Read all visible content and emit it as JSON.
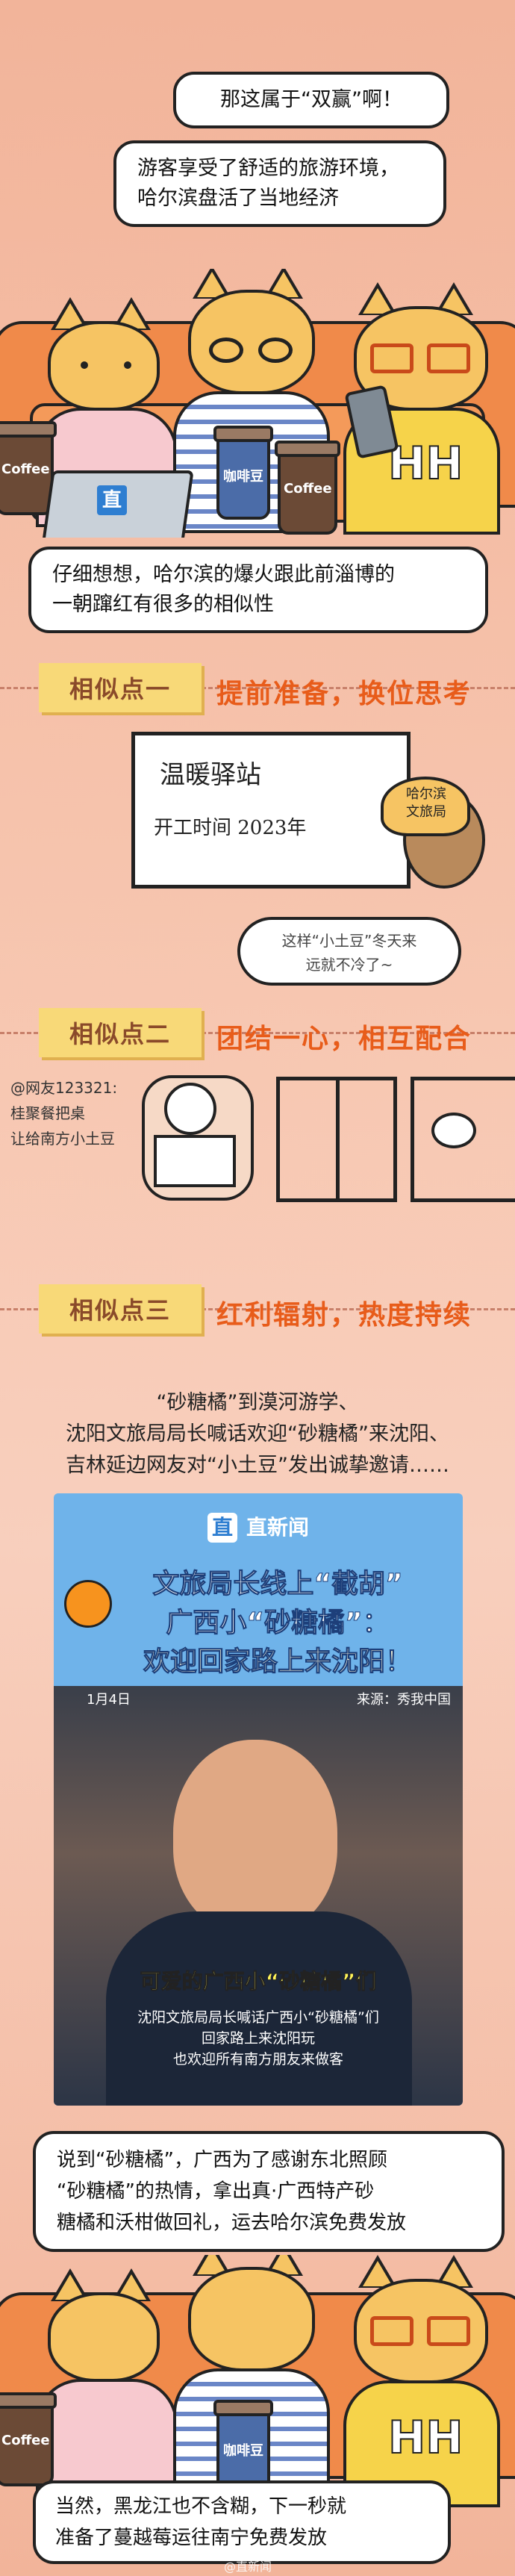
{
  "scene1": {
    "bubble_top": "那这属于“双赢”啊！",
    "bubble_mid_line1": "游客享受了舒适的旅游环境，",
    "bubble_mid_line2": "哈尔滨盘活了当地经济",
    "cup_left_label": "Coffee",
    "cup_mid_label": "咖啡豆",
    "cup_right_label": "Coffee",
    "laptop_logo": "直",
    "shirt_letters": "HH"
  },
  "bubble_similar_line1": "仔细想想，哈尔滨的爆火跟此前淄博的",
  "bubble_similar_line2": "一朝蹿红有很多的相似性",
  "point1": {
    "label": "相似点一",
    "title": "提前准备，换位思考",
    "board_title": "温暖驿站",
    "board_text": "开工时间 2023年",
    "mascot_text_line1": "哈尔滨",
    "mascot_text_line2": "文旅局",
    "speech_line1": "这样“小土豆”冬天来",
    "speech_line2": "远就不冷了~"
  },
  "point2": {
    "label": "相似点二",
    "title": "团结一心，相互配合",
    "note_line1": "@网友123321:",
    "note_line2": "桂聚餐把桌",
    "note_line3": "让给南方小土豆"
  },
  "point3": {
    "label": "相似点三",
    "title": "红利辐射，热度持续"
  },
  "news_intro": {
    "line1": "“砂糖橘”到漠河游学、",
    "line2": "沈阳文旅局局长喊话欢迎“砂糖橘”来沈阳、",
    "line3": "吉林延边网友对“小土豆”发出诚挚邀请……"
  },
  "video": {
    "logo_left": "直",
    "logo_right": "直新闻",
    "headline_line1": "文旅局长线上“截胡”",
    "headline_line2": "广西小“砂糖橘”：",
    "headline_line3": "欢迎回家路上来沈阳！",
    "date": "1月4日",
    "source": "来源：秀我中国",
    "caption_main": "可爱的广西小“砂糖橘”们",
    "caption_sub1": "沈阳文旅局局长喊话广西小“砂糖橘”们",
    "caption_sub2": "回家路上来沈阳玩",
    "caption_sub3": "也欢迎所有南方朋友来做客"
  },
  "bubble_gift": {
    "line1": "说到“砂糖橘”，广西为了感谢东北照顾",
    "line2": "“砂糖橘”的热情，拿出真·广西特产砂",
    "line3": "糖橘和沃柑做回礼，运去哈尔滨免费发放"
  },
  "bubble_final": {
    "line1": "当然，黑龙江也不含糊，下一秒就",
    "line2": "准备了蔓越莓运往南宁免费发放"
  },
  "watermark": "@直新闻",
  "colors": {
    "background": "#f2b49a",
    "accent_orange": "#e85c1a",
    "label_yellow": "#f8d978",
    "video_blue": "#6fb3ea"
  }
}
